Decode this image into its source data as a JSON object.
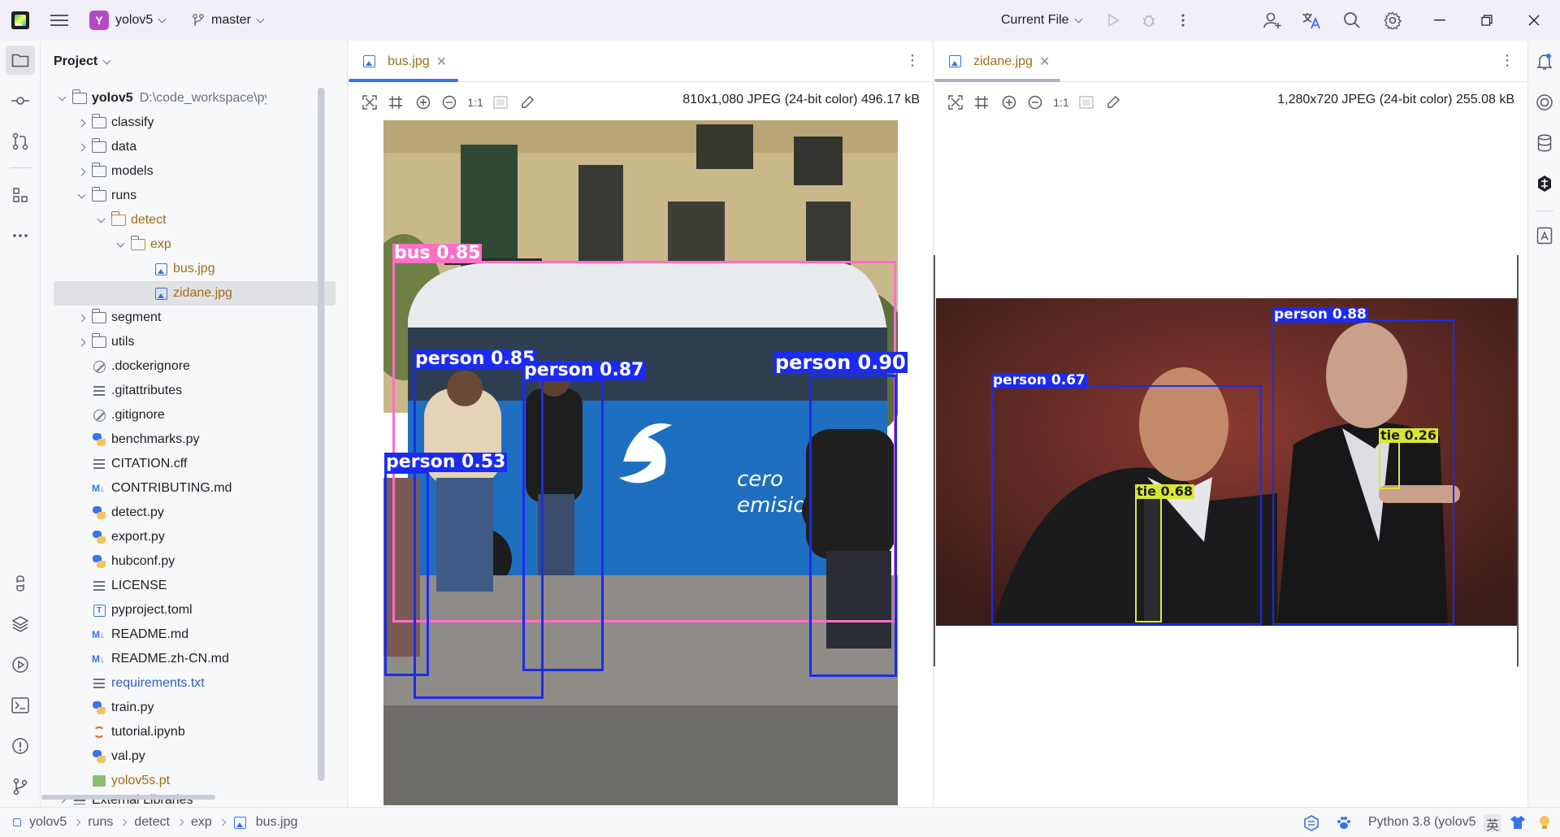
{
  "titlebar": {
    "project_initial": "Y",
    "project_name": "yolov5",
    "branch": "master",
    "run_config": "Current File"
  },
  "project_panel": {
    "title": "Project",
    "root": {
      "name": "yolov5",
      "path": "D:\\code_workspace\\python_works"
    },
    "items": [
      {
        "name": "classify",
        "type": "folder"
      },
      {
        "name": "data",
        "type": "folder"
      },
      {
        "name": "models",
        "type": "folder"
      },
      {
        "name": "runs",
        "type": "folder"
      },
      {
        "name": "detect",
        "type": "folder"
      },
      {
        "name": "exp",
        "type": "folder"
      },
      {
        "name": "bus.jpg",
        "type": "image"
      },
      {
        "name": "zidane.jpg",
        "type": "image"
      },
      {
        "name": "segment",
        "type": "folder"
      },
      {
        "name": "utils",
        "type": "folder"
      },
      {
        "name": ".dockerignore",
        "type": "ignore"
      },
      {
        "name": ".gitattributes",
        "type": "text"
      },
      {
        "name": ".gitignore",
        "type": "ignore"
      },
      {
        "name": "benchmarks.py",
        "type": "python"
      },
      {
        "name": "CITATION.cff",
        "type": "text"
      },
      {
        "name": "CONTRIBUTING.md",
        "type": "markdown"
      },
      {
        "name": "detect.py",
        "type": "python"
      },
      {
        "name": "export.py",
        "type": "python"
      },
      {
        "name": "hubconf.py",
        "type": "python"
      },
      {
        "name": "LICENSE",
        "type": "text"
      },
      {
        "name": "pyproject.toml",
        "type": "toml"
      },
      {
        "name": "README.md",
        "type": "markdown"
      },
      {
        "name": "README.zh-CN.md",
        "type": "markdown"
      },
      {
        "name": "requirements.txt",
        "type": "text"
      },
      {
        "name": "train.py",
        "type": "python"
      },
      {
        "name": "tutorial.ipynb",
        "type": "notebook"
      },
      {
        "name": "val.py",
        "type": "python"
      },
      {
        "name": "yolov5s.pt",
        "type": "model"
      },
      {
        "name": "External Libraries",
        "type": "library"
      }
    ],
    "markdown_badge": "M↓",
    "toml_badge": "T"
  },
  "editors": {
    "left": {
      "tab": "bus.jpg",
      "zoom_label": "1:1",
      "info": "810x1,080 JPEG (24-bit color) 496.17 kB",
      "detections": [
        {
          "label": "bus 0.85",
          "color": "#ff6ec7"
        },
        {
          "label": "person 0.85",
          "color": "#1c2bf0"
        },
        {
          "label": "person 0.87",
          "color": "#1c2bf0"
        },
        {
          "label": "person 0.90",
          "color": "#1c2bf0"
        },
        {
          "label": "person 0.53",
          "color": "#1c2bf0"
        }
      ]
    },
    "right": {
      "tab": "zidane.jpg",
      "zoom_label": "1:1",
      "info": "1,280x720 JPEG (24-bit color) 255.08 kB",
      "detections": [
        {
          "label": "person 0.88",
          "color": "#1c2bf0"
        },
        {
          "label": "person 0.67",
          "color": "#1c2bf0"
        },
        {
          "label": "tie 0.26",
          "color": "#d8e832"
        },
        {
          "label": "tie 0.68",
          "color": "#d8e832"
        }
      ]
    }
  },
  "statusbar": {
    "breadcrumb": [
      "yolov5",
      "runs",
      "detect",
      "exp",
      "bus.jpg"
    ],
    "interpreter": "Python 3.8 (yolov5",
    "ime": "英"
  },
  "colors": {
    "accent": "#3574f0",
    "titlebar_bg": "#f2eff8",
    "panel_bg": "#f7f8fa"
  }
}
